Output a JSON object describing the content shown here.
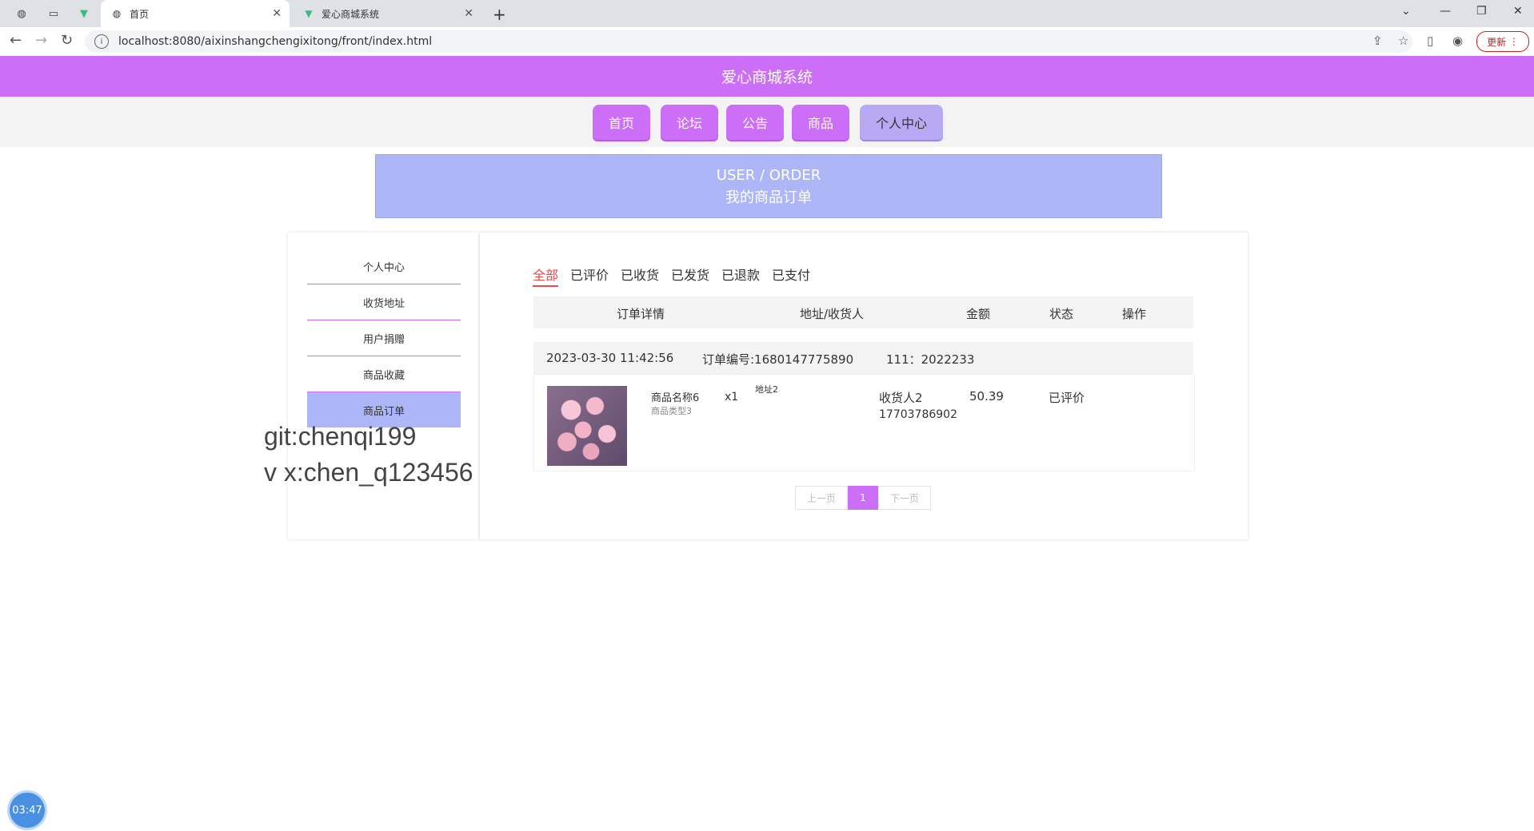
{
  "browser": {
    "tabs": [
      {
        "title": "首页",
        "icon": "globe-icon"
      },
      {
        "title": "爱心商城系统",
        "icon": "vue-icon"
      }
    ],
    "url": "localhost:8080/aixinshangchengixitong/front/index.html",
    "update_label": "更新"
  },
  "site": {
    "title": "爱心商城系统",
    "nav": [
      "首页",
      "论坛",
      "公告",
      "商品",
      "个人中心"
    ],
    "banner_en": "USER / ORDER",
    "banner_cn": "我的商品订单"
  },
  "sidebar": {
    "items": [
      "个人中心",
      "收货地址",
      "用户捐赠",
      "商品收藏",
      "商品订单"
    ]
  },
  "watermark": {
    "line1": "git:chenqi199",
    "line2": "v x:chen_q123456"
  },
  "orders": {
    "filters": [
      "全部",
      "已评价",
      "已收货",
      "已发货",
      "已退款",
      "已支付"
    ],
    "columns": [
      "订单详情",
      "地址/收货人",
      "金额",
      "状态",
      "操作"
    ],
    "item": {
      "datetime": "2023-03-30 11:42:56",
      "order_no": "订单编号:1680147775890",
      "user": "111：2022233",
      "product_name": "商品名称6",
      "product_type": "商品类型3",
      "qty": "x1",
      "address": "地址2",
      "receiver": "收货人2",
      "phone": "17703786902",
      "amount": "50.39",
      "status": "已评价"
    },
    "pager": {
      "prev": "上一页",
      "current": "1",
      "next": "下一页"
    }
  },
  "clock": "03:47",
  "colors": {
    "brand": "#cc6ef7",
    "banner": "#adb7f7",
    "active_filter": "#e24d4d"
  }
}
